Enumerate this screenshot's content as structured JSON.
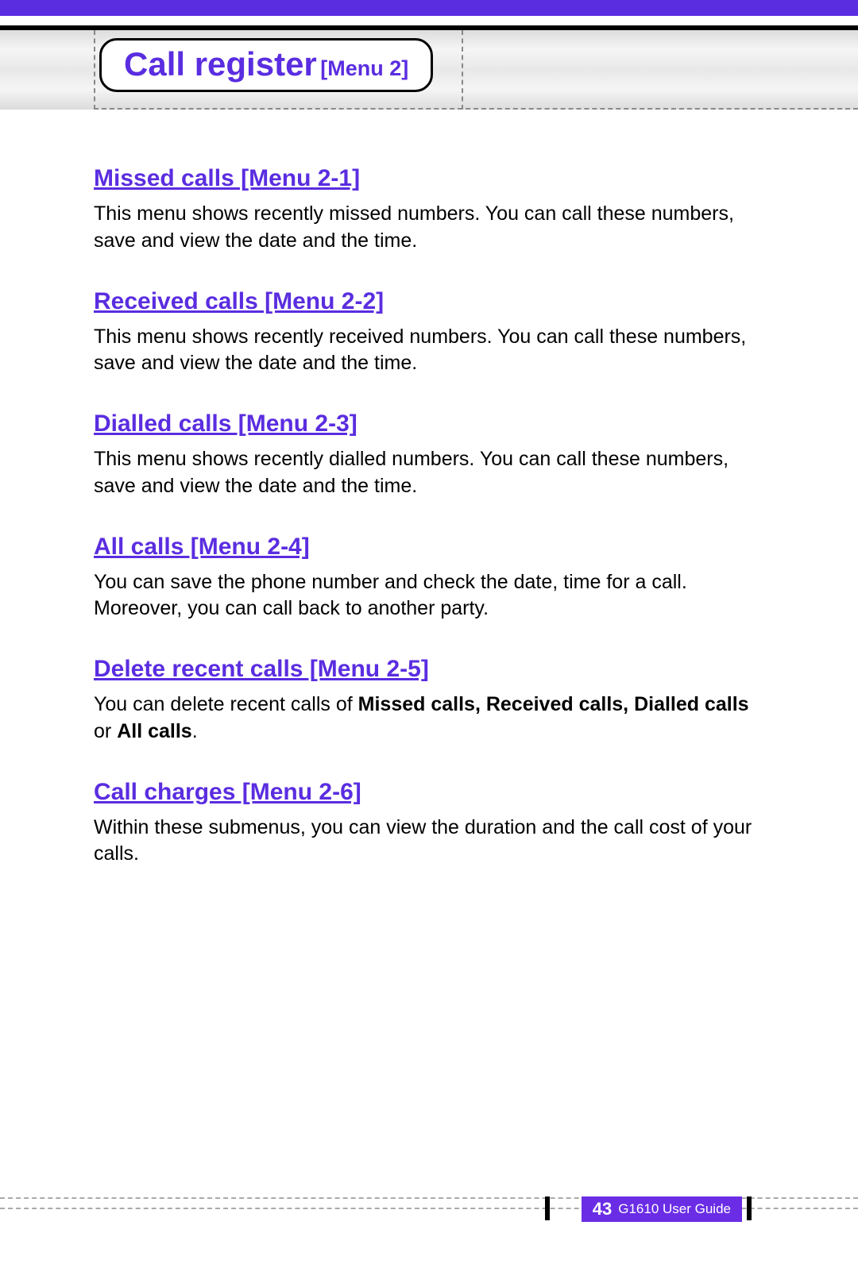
{
  "header": {
    "title_main": "Call register",
    "title_sub": "[Menu 2]"
  },
  "sections": [
    {
      "heading": "Missed calls [Menu 2-1]",
      "body": "This menu shows recently missed numbers. You can call these numbers, save and view the date and the time."
    },
    {
      "heading": "Received calls [Menu 2-2]",
      "body": "This menu shows recently received numbers. You can call these numbers, save and view the date and the time."
    },
    {
      "heading": "Dialled calls [Menu 2-3]",
      "body": "This menu shows recently dialled numbers. You can call these numbers, save and view the date and the time."
    },
    {
      "heading": "All calls [Menu 2-4]",
      "body": "You can save the phone number and check the date, time for a call. Moreover, you can call back to another party."
    },
    {
      "heading": "Delete recent calls [Menu 2-5]",
      "body_parts": [
        {
          "t": "You can delete recent calls of ",
          "b": false
        },
        {
          "t": "Missed calls, Received calls, Dialled calls",
          "b": true
        },
        {
          "t": " or ",
          "b": false
        },
        {
          "t": "All calls",
          "b": true
        },
        {
          "t": ".",
          "b": false
        }
      ]
    },
    {
      "heading": "Call charges [Menu 2-6]",
      "body": "Within these submenus, you can view the duration and the call cost of your calls."
    }
  ],
  "footer": {
    "page": "43",
    "guide": "G1610 User Guide"
  }
}
